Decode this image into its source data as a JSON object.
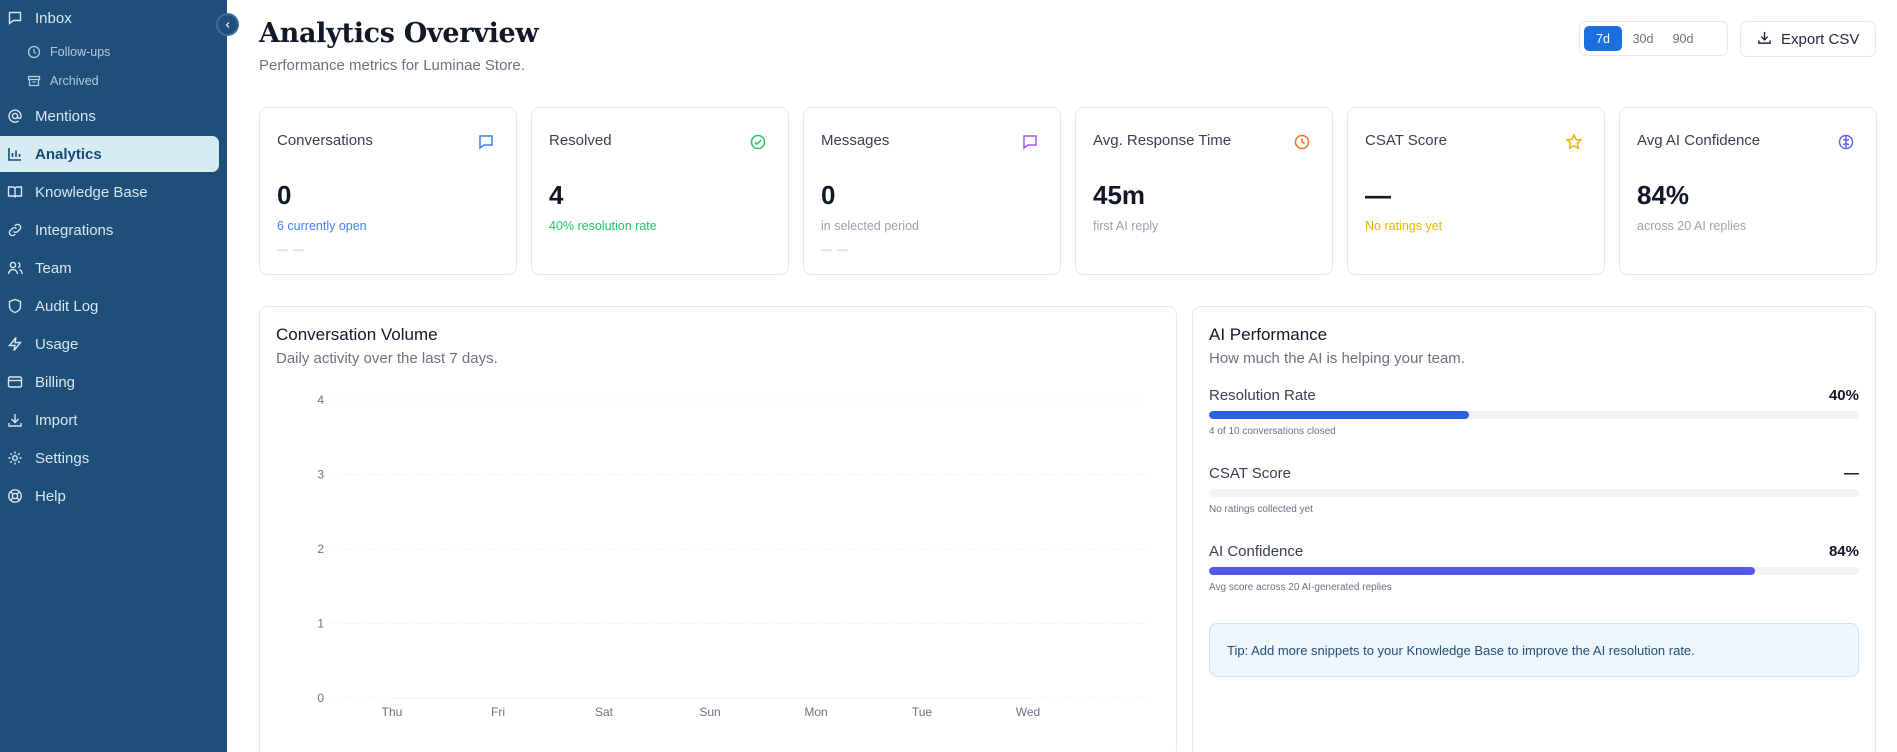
{
  "sidebar": {
    "items": [
      {
        "label": "Inbox",
        "icon": "message-square-icon"
      },
      {
        "label": "Follow-ups",
        "icon": "clock-icon"
      },
      {
        "label": "Archived",
        "icon": "archive-icon"
      },
      {
        "label": "Mentions",
        "icon": "at-sign-icon"
      },
      {
        "label": "Analytics",
        "icon": "bar-chart-icon"
      },
      {
        "label": "Knowledge Base",
        "icon": "book-open-icon"
      },
      {
        "label": "Integrations",
        "icon": "link-icon"
      },
      {
        "label": "Team",
        "icon": "users-icon"
      },
      {
        "label": "Audit Log",
        "icon": "shield-icon"
      },
      {
        "label": "Usage",
        "icon": "zap-icon"
      },
      {
        "label": "Billing",
        "icon": "credit-card-icon"
      },
      {
        "label": "Import",
        "icon": "download-icon"
      },
      {
        "label": "Settings",
        "icon": "gear-icon"
      },
      {
        "label": "Help",
        "icon": "life-buoy-icon"
      }
    ],
    "active_item": "Analytics"
  },
  "header": {
    "title": "Analytics Overview",
    "subtitle": "Performance metrics for Luminae Store.",
    "ranges": [
      "7d",
      "30d",
      "90d"
    ],
    "selected_range": "7d",
    "export_label": "Export CSV"
  },
  "stats": [
    {
      "title": "Conversations",
      "value": "0",
      "sub": "6 currently open",
      "trend": "— —",
      "icon": "message-square-icon",
      "color": "#3b82f6"
    },
    {
      "title": "Resolved",
      "value": "4",
      "sub": "40% resolution rate",
      "icon": "check-circle-icon",
      "color": "#22c55e"
    },
    {
      "title": "Messages",
      "value": "0",
      "sub": "in selected period",
      "trend": "— —",
      "icon": "message-square-icon",
      "color": "#a855f7"
    },
    {
      "title": "Avg. Response Time",
      "value": "45m",
      "sub": "first AI reply",
      "icon": "clock-icon",
      "color": "#f97316"
    },
    {
      "title": "CSAT Score",
      "value": "—",
      "sub": "No ratings yet",
      "icon": "star-icon",
      "color": "#eab308"
    },
    {
      "title": "Avg AI Confidence",
      "value": "84%",
      "sub": "across 20 AI replies",
      "icon": "brain-icon",
      "color": "#6366f1"
    }
  ],
  "volume_panel": {
    "title": "Conversation Volume",
    "subtitle": "Daily activity over the last 7 days."
  },
  "chart_data": {
    "type": "line",
    "categories": [
      "Thu",
      "Fri",
      "Sat",
      "Sun",
      "Mon",
      "Tue",
      "Wed"
    ],
    "values": [
      0,
      0,
      0,
      0,
      0,
      0,
      0
    ],
    "yticks": [
      "4",
      "3",
      "2",
      "1",
      "0"
    ],
    "ylim": [
      0,
      4
    ],
    "grid": true,
    "title": "",
    "xlabel": "",
    "ylabel": ""
  },
  "ai_panel": {
    "title": "AI Performance",
    "subtitle": "How much the AI is helping your team.",
    "metrics": [
      {
        "label": "Resolution Rate",
        "value": "40%",
        "fraction": 0.4,
        "note": "4 of 10 conversations closed",
        "color": "#2d5fe0"
      },
      {
        "label": "CSAT Score",
        "value": "—",
        "fraction": 0,
        "note": "No ratings collected yet",
        "color": "#2d5fe0"
      },
      {
        "label": "AI Confidence",
        "value": "84%",
        "fraction": 0.84,
        "note": "Avg score across 20 AI-generated replies",
        "color": "#5458e8"
      }
    ],
    "tip": "Tip: Add more snippets to your Knowledge Base to improve the AI resolution rate."
  }
}
